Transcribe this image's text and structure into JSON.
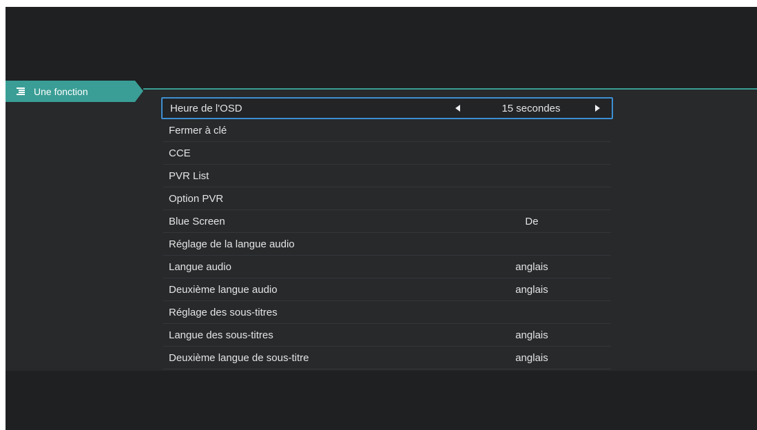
{
  "tab": {
    "label": "Une fonction",
    "icon": "menu-list-icon"
  },
  "colors": {
    "accent": "#3a9e96",
    "selection": "#3e8fd3",
    "background": "#1e2021"
  },
  "menu": {
    "items": [
      {
        "label": "Heure de l'OSD",
        "value": "15 secondes"
      },
      {
        "label": "Fermer à clé",
        "value": ""
      },
      {
        "label": "CCE",
        "value": ""
      },
      {
        "label": "PVR List",
        "value": ""
      },
      {
        "label": "Option PVR",
        "value": ""
      },
      {
        "label": "Blue Screen",
        "value": "De"
      },
      {
        "label": "Réglage de la langue audio",
        "value": ""
      },
      {
        "label": "Langue audio",
        "value": "anglais"
      },
      {
        "label": "Deuxième langue audio",
        "value": "anglais"
      },
      {
        "label": "Réglage des sous-titres",
        "value": ""
      },
      {
        "label": "Langue des sous-titres",
        "value": "anglais"
      },
      {
        "label": "Deuxième langue de sous-titre",
        "value": "anglais"
      }
    ]
  }
}
